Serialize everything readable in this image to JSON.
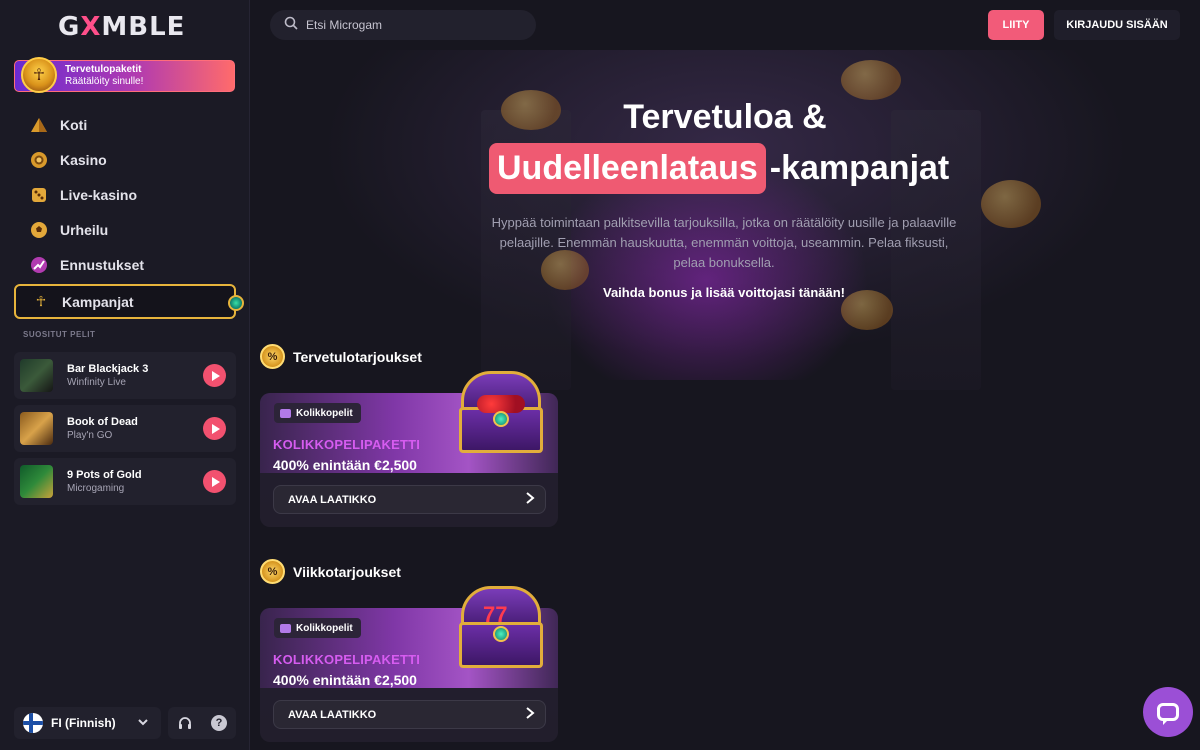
{
  "brand": {
    "logo_pre": "G",
    "logo_x": "X",
    "logo_post": "MBLE"
  },
  "sidebar": {
    "promo": {
      "title": "Tervetulopaketit",
      "subtitle": "Räätälöity sinulle!"
    },
    "items": [
      {
        "label": "Koti",
        "icon": "pyramid-icon"
      },
      {
        "label": "Kasino",
        "icon": "chip-icon"
      },
      {
        "label": "Live-kasino",
        "icon": "dice-icon"
      },
      {
        "label": "Urheilu",
        "icon": "ball-icon"
      },
      {
        "label": "Ennustukset",
        "icon": "chart-up-icon"
      },
      {
        "label": "Kampanjat",
        "icon": "ankh-icon",
        "active": true
      }
    ],
    "section_label": "SUOSITUT PELIT",
    "games": [
      {
        "title": "Bar Blackjack 3",
        "provider": "Winfinity Live"
      },
      {
        "title": "Book of Dead",
        "provider": "Play'n GO"
      },
      {
        "title": "9 Pots of Gold",
        "provider": "Microgaming"
      }
    ],
    "language": "FI (Finnish)"
  },
  "header": {
    "search_placeholder": "Etsi Microgam",
    "join_label": "LIITY",
    "login_label": "KIRJAUDU SISÄÄN"
  },
  "hero": {
    "title_line1": "Tervetuloa &",
    "title_highlight": "Uudelleenlataus",
    "title_rest": "-kampanjat",
    "description": "Hyppää toimintaan palkitsevilla tarjouksilla, jotka on räätälöity uusille ja palaaville pelaajille. Enemmän hauskuutta, enemmän voittoja, useammin. Pelaa fiksusti, pelaa bonuksella.",
    "cta": "Vaihda bonus ja lisää voittojasi tänään!"
  },
  "sections": [
    {
      "title": "Tervetulotarjoukset",
      "card": {
        "tag": "Kolikkopelit",
        "kicker": "KOLIKKOPELIPAKETTI",
        "value": "400% enintään €2,500",
        "button": "AVAA LAATIKKO"
      }
    },
    {
      "title": "Viikkotarjoukset",
      "card": {
        "tag": "Kolikkopelit",
        "kicker": "KOLIKKOPELIPAKETTI",
        "value": "400% enintään €2,500",
        "button": "AVAA LAATIKKO"
      }
    }
  ],
  "colors": {
    "accent": "#f25b79",
    "gold": "#e7b43c",
    "sidebar": "#1b1a25",
    "background": "#17161f"
  }
}
